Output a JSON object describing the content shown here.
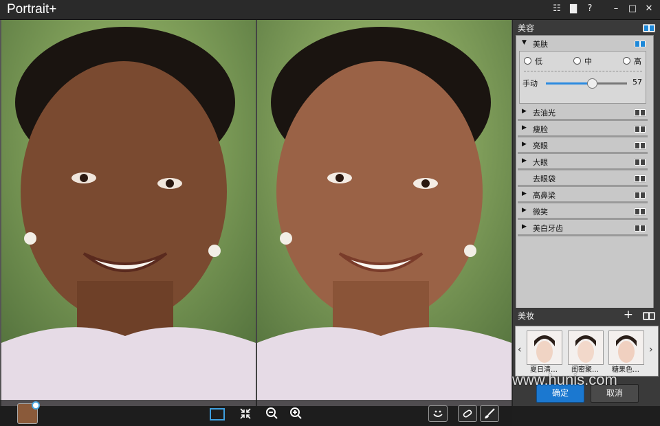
{
  "app": {
    "title": "Portrait+"
  },
  "titlebar": {
    "icons": [
      "list-icon",
      "chat-icon",
      "help-icon",
      "minimize-icon",
      "maximize-icon",
      "close-icon"
    ],
    "help_glyph": "?"
  },
  "panel": {
    "beauty_section": "美容",
    "skin": {
      "title": "美肤",
      "levels": [
        "低",
        "中",
        "高"
      ],
      "manual_label": "手动",
      "manual_value": "57",
      "manual_fraction": 0.57
    },
    "items": [
      {
        "label": "去油光",
        "expandable": true
      },
      {
        "label": "瘦脸",
        "expandable": true
      },
      {
        "label": "亮眼",
        "expandable": true
      },
      {
        "label": "大眼",
        "expandable": true
      },
      {
        "label": "去眼袋",
        "expandable": false
      },
      {
        "label": "高鼻梁",
        "expandable": true
      },
      {
        "label": "微笑",
        "expandable": true
      },
      {
        "label": "美白牙齿",
        "expandable": true
      }
    ],
    "makeup_section": "美妆",
    "add_glyph": "+",
    "presets": [
      "夏日清…",
      "闺密聚…",
      "糖果色…"
    ],
    "ok_label": "确定",
    "cancel_label": "取消",
    "nav_prev": "‹",
    "nav_next": "›"
  },
  "watermark": "www.hunis.com",
  "colors": {
    "accent": "#1b78d0",
    "panel_bg": "#3a3a3a",
    "box_bg": "#c8c8c8"
  }
}
